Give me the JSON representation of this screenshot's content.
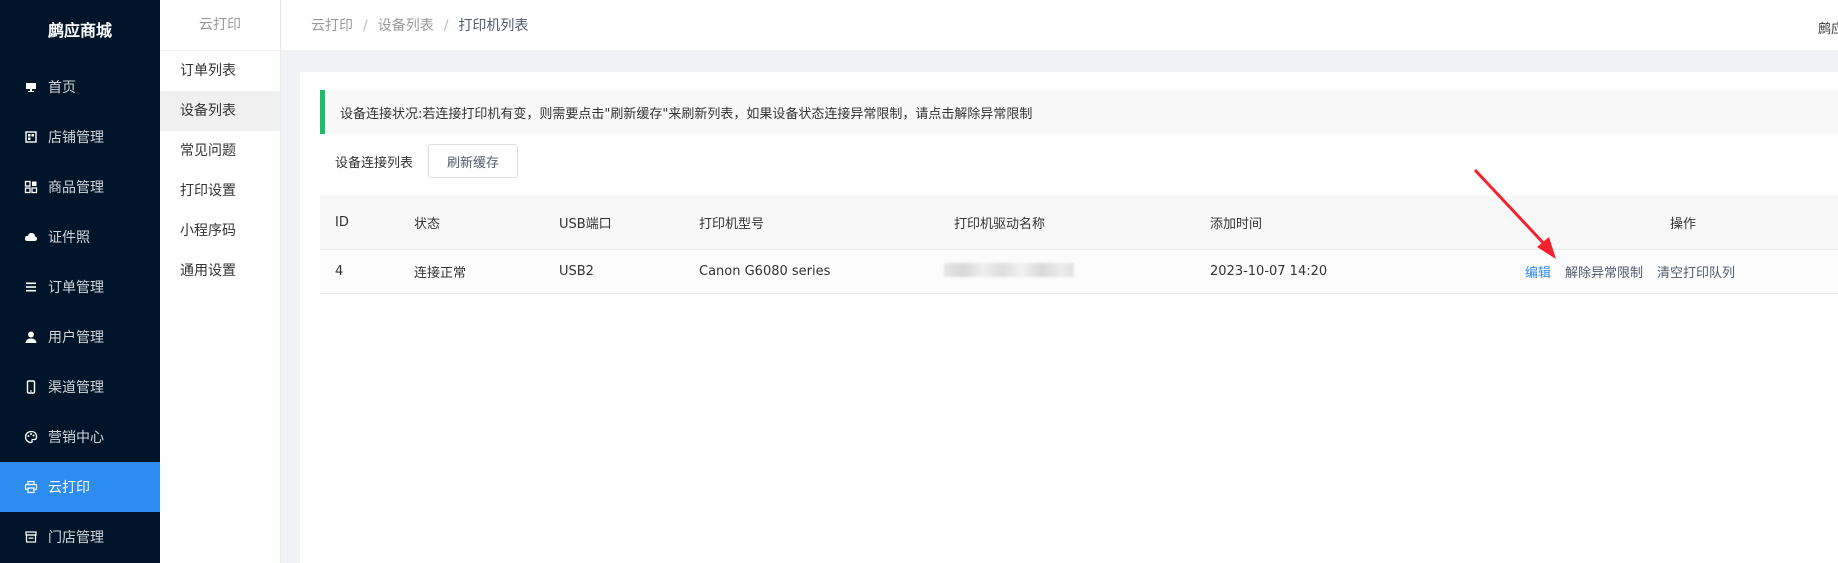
{
  "app": {
    "brand": "鹧应商城"
  },
  "sidebar": {
    "items": [
      {
        "label": "首页",
        "icon": "monitor-icon"
      },
      {
        "label": "店铺管理",
        "icon": "store-icon"
      },
      {
        "label": "商品管理",
        "icon": "grid-icon"
      },
      {
        "label": "证件照",
        "icon": "cloud-icon"
      },
      {
        "label": "订单管理",
        "icon": "list-icon"
      },
      {
        "label": "用户管理",
        "icon": "user-icon"
      },
      {
        "label": "渠道管理",
        "icon": "mobile-icon"
      },
      {
        "label": "营销中心",
        "icon": "palette-icon"
      },
      {
        "label": "云打印",
        "icon": "printer-icon",
        "active": true
      },
      {
        "label": "门店管理",
        "icon": "shop-icon"
      }
    ]
  },
  "submenu": {
    "title": "云打印",
    "items": [
      {
        "label": "订单列表"
      },
      {
        "label": "设备列表",
        "active": true
      },
      {
        "label": "常见问题"
      },
      {
        "label": "打印设置"
      },
      {
        "label": "小程序码"
      },
      {
        "label": "通用设置"
      }
    ]
  },
  "header": {
    "breadcrumb": [
      "云打印",
      "设备列表",
      "打印机列表"
    ],
    "user": "鹧应"
  },
  "main": {
    "notice": "设备连接状况:若连接打印机有变，则需要点击\"刷新缓存\"来刷新列表，如果设备状态连接异常限制，请点击解除异常限制",
    "toolbar": {
      "label": "设备连接列表",
      "refresh_button": "刷新缓存"
    },
    "table": {
      "columns": [
        "ID",
        "状态",
        "USB端口",
        "打印机型号",
        "打印机驱动名称",
        "添加时间",
        "操作"
      ],
      "rows": [
        {
          "id": "4",
          "status": "连接正常",
          "usb": "USB2",
          "model": "Canon G6080 series",
          "driver": "",
          "added": "2023-10-07 14:20",
          "actions": [
            "编辑",
            "解除异常限制",
            "清空打印队列"
          ]
        }
      ]
    }
  },
  "colors": {
    "sidebar_bg": "#001529",
    "active": "#2d8cf0",
    "notice_border": "#19be6b",
    "annotation_arrow": "#f5222d"
  }
}
